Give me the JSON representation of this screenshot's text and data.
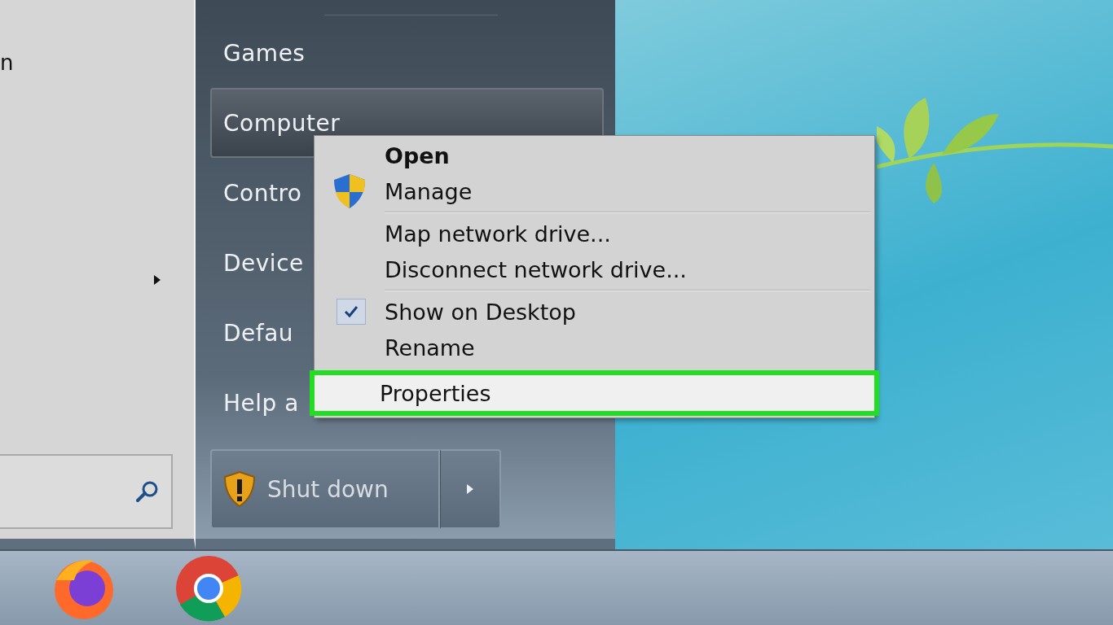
{
  "start_menu": {
    "left_pane": {
      "program_label": "n"
    },
    "places": [
      {
        "label": "Games",
        "selected": false
      },
      {
        "label": "Computer",
        "selected": true
      },
      {
        "label": "Contro",
        "selected": false
      },
      {
        "label": "Device",
        "selected": false
      },
      {
        "label": "Defau",
        "selected": false
      },
      {
        "label": "Help a",
        "selected": false
      }
    ],
    "shutdown_button": {
      "label": "Shut down"
    }
  },
  "context_menu": {
    "groups": [
      [
        {
          "label": "Open",
          "kind": "default",
          "checked": false,
          "selected": false
        },
        {
          "label": "Manage",
          "kind": "shield",
          "checked": false,
          "selected": false
        }
      ],
      [
        {
          "label": "Map network drive...",
          "kind": "plain",
          "checked": false,
          "selected": false
        },
        {
          "label": "Disconnect network drive...",
          "kind": "plain",
          "checked": false,
          "selected": false
        }
      ],
      [
        {
          "label": "Show on Desktop",
          "kind": "plain",
          "checked": true,
          "selected": false
        },
        {
          "label": "Rename",
          "kind": "plain",
          "checked": false,
          "selected": false
        },
        {
          "label": "Properties",
          "kind": "plain",
          "checked": false,
          "selected": true
        }
      ]
    ]
  },
  "taskbar": {
    "pinned": [
      {
        "kind": "firefox"
      },
      {
        "kind": "chrome"
      }
    ]
  }
}
